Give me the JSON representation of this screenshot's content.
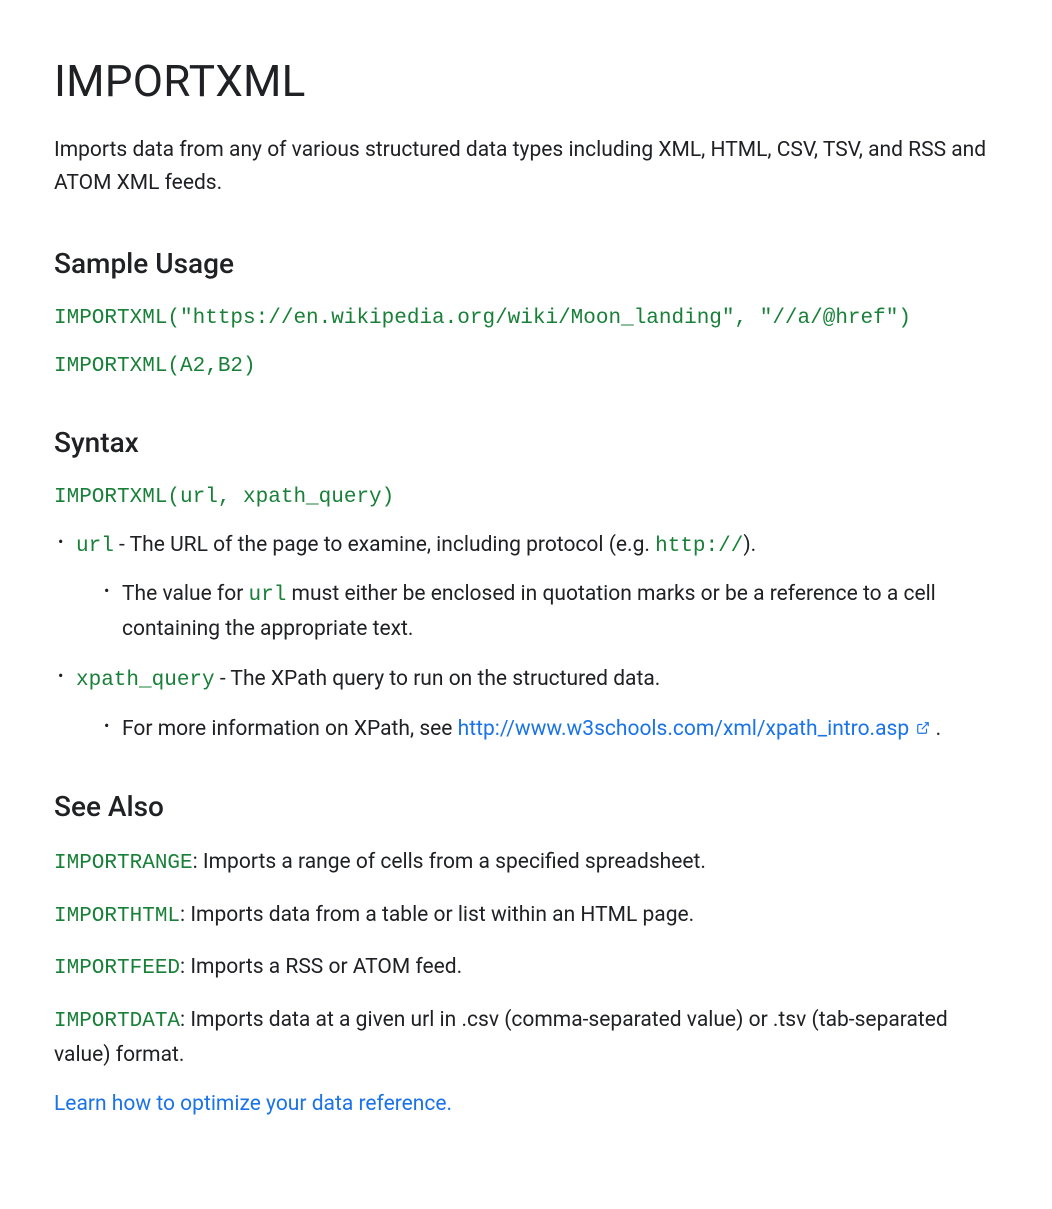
{
  "title": "IMPORTXML",
  "intro": "Imports data from any of various structured data types including XML, HTML, CSV, TSV, and RSS and ATOM XML feeds.",
  "sampleUsage": {
    "heading": "Sample Usage",
    "example1": "IMPORTXML(\"https://en.wikipedia.org/wiki/Moon_landing\", \"//a/@href\")",
    "example2": "IMPORTXML(A2,B2)"
  },
  "syntax": {
    "heading": "Syntax",
    "signature": "IMPORTXML(url, xpath_query)",
    "params": {
      "url": {
        "name": "url",
        "desc": " - The URL of the page to examine, including protocol (e.g. ",
        "descCode": "http://",
        "descAfter": ").",
        "subPrefix": "The value for ",
        "subCode": "url",
        "subSuffix": " must either be enclosed in quotation marks or be a reference to a cell containing the appropriate text."
      },
      "xpath": {
        "name": "xpath_query",
        "desc": " - The XPath query to run on the structured data.",
        "subPrefix": "For more information on XPath, see ",
        "subLink": "http://www.w3schools.com/xml/xpath_intro.asp",
        "subSuffix": " ."
      }
    }
  },
  "seeAlso": {
    "heading": "See Also",
    "items": [
      {
        "code": "IMPORTRANGE",
        "desc": ": Imports a range of cells from a specified spreadsheet."
      },
      {
        "code": "IMPORTHTML",
        "desc": ": Imports data from a table or list within an HTML page."
      },
      {
        "code": "IMPORTFEED",
        "desc": ": Imports a RSS or ATOM feed."
      },
      {
        "code": "IMPORTDATA",
        "desc": ": Imports data at a given url in .csv (comma-separated value) or .tsv (tab-separated value) format."
      }
    ],
    "learnLink": "Learn how to optimize your data reference.",
    "period": "."
  }
}
